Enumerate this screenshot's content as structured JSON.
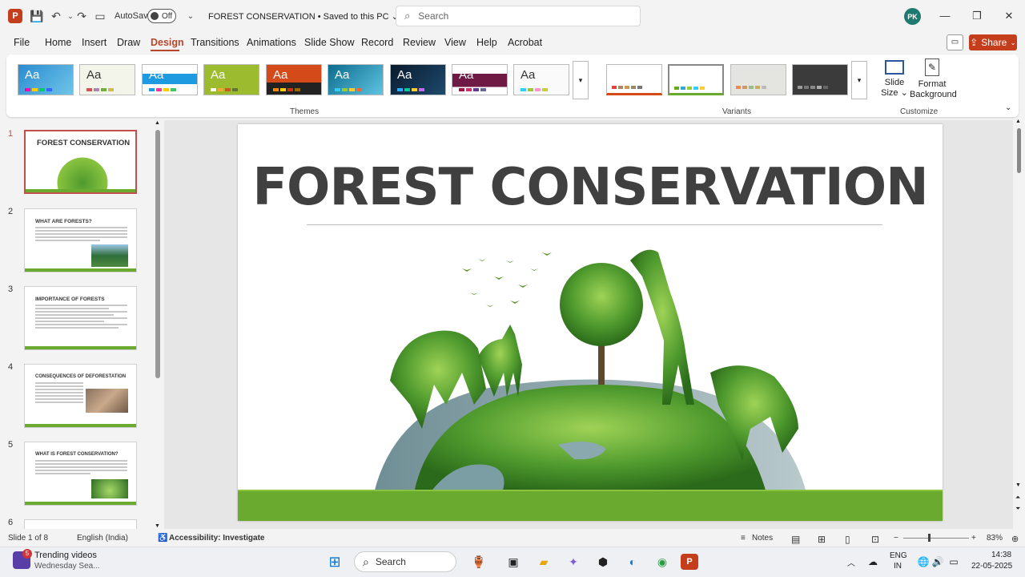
{
  "titlebar": {
    "app_icon": "P",
    "autosave_label": "AutoSave",
    "autosave_state": "Off",
    "doc_title": "FOREST CONSERVATION • Saved to this PC ⌄",
    "search_placeholder": "Search",
    "avatar_initials": "PK"
  },
  "menu": [
    "File",
    "Home",
    "Insert",
    "Draw",
    "Design",
    "Transitions",
    "Animations",
    "Slide Show",
    "Record",
    "Review",
    "View",
    "Help",
    "Acrobat"
  ],
  "share_label": "Share",
  "ribbon": {
    "theme_glyph": "Aa",
    "themes_label": "Themes",
    "variants_label": "Variants",
    "slide_size_label": "Slide Size ⌄",
    "format_background_label": "Format Background",
    "customize_label": "Customize"
  },
  "slides": [
    {
      "num": "1",
      "title": "FOREST CONSERVATION"
    },
    {
      "num": "2",
      "title": "WHAT ARE FORESTS?"
    },
    {
      "num": "3",
      "title": "IMPORTANCE OF FORESTS"
    },
    {
      "num": "4",
      "title": "CONSEQUENCES OF DEFORESTATION"
    },
    {
      "num": "5",
      "title": "WHAT IS FOREST CONSERVATION?"
    },
    {
      "num": "6",
      "title": ""
    }
  ],
  "main_slide": {
    "title": "FOREST CONSERVATION"
  },
  "status": {
    "slide_counter": "Slide 1 of 8",
    "language": "English (India)",
    "accessibility": "Accessibility: Investigate",
    "notes": "Notes",
    "zoom": "83%"
  },
  "taskbar": {
    "news_title": "Trending videos",
    "news_sub": "Wednesday Sea...",
    "news_badge": "5",
    "search_label": "Search",
    "lang_line1": "ENG",
    "lang_line2": "IN",
    "time": "14:38",
    "date": "22-05-2025"
  },
  "colors": {
    "accent": "#b7472a",
    "share": "#c43e1c",
    "slide_band": "#6aaa2e"
  }
}
